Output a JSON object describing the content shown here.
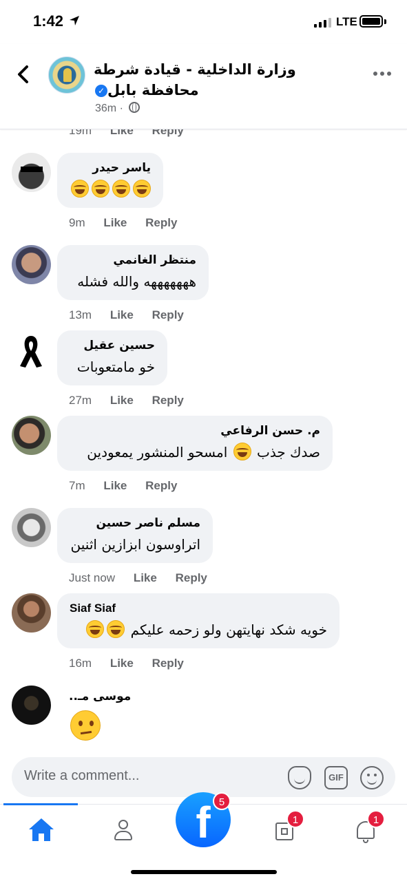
{
  "status_bar": {
    "time": "1:42",
    "network": "LTE"
  },
  "header": {
    "page_name": "وزارة الداخلية - قيادة شرطة محافظة بابل",
    "timestamp": "36m ·",
    "back_icon": "chevron-left-icon",
    "more_icon": "more-horizontal-icon"
  },
  "partial_row": {
    "time": "19m",
    "like": "Like",
    "reply": "Reply"
  },
  "comments": [
    {
      "author": "ياسر حيدر",
      "text": "",
      "emojis": "😂😂😂😂",
      "time": "9m",
      "like": "Like",
      "reply": "Reply"
    },
    {
      "author": "منتظر الغانمي",
      "text": "هههههههه والله فشله",
      "time": "13m",
      "like": "Like",
      "reply": "Reply"
    },
    {
      "author": "حسين عقيل",
      "text": "خو مامتعوبات",
      "time": "27m",
      "like": "Like",
      "reply": "Reply"
    },
    {
      "author": "م. حسن الرفاعي",
      "text_before": "صدك جذب",
      "text_after": "امسحو المنشور يمعودين",
      "emoji": "😂",
      "time": "7m",
      "like": "Like",
      "reply": "Reply"
    },
    {
      "author": "مسلم  ناصر حسين",
      "text": "اتراوسون ابزازين اثنين",
      "time": "Just now",
      "like": "Like",
      "reply": "Reply"
    },
    {
      "author": "Siaf Siaf",
      "text": "خويه شكد نهايتهن ولو زحمه عليكم",
      "emojis": "😂😂",
      "time": "16m",
      "like": "Like",
      "reply": "Reply"
    },
    {
      "author": "موسى مـ..",
      "emoji": "🤔"
    }
  ],
  "composer": {
    "placeholder": "Write a comment...",
    "gif_label": "GIF"
  },
  "tabbar": {
    "fab_badge": "5",
    "pages_badge": "1",
    "notifications_badge": "1"
  },
  "colors": {
    "accent": "#1877f2",
    "bubble": "#f0f2f5",
    "secondary_text": "#65676b",
    "badge": "#e41e3f"
  }
}
